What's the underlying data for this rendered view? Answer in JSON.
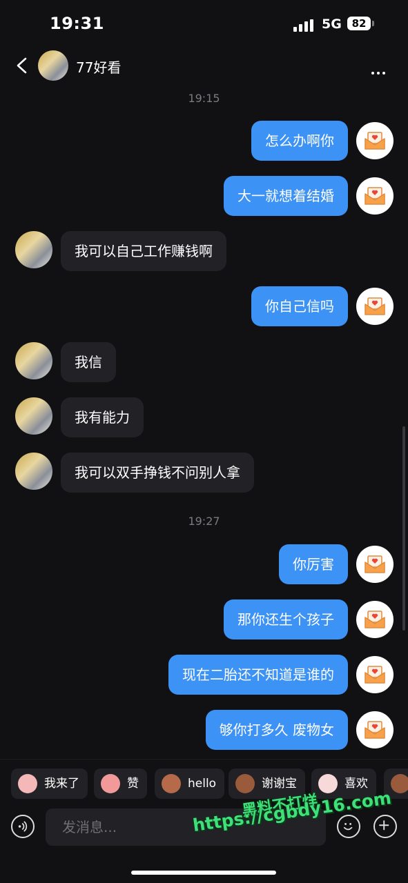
{
  "status_bar": {
    "time": "19:31",
    "network": "5G",
    "battery": "82"
  },
  "header": {
    "name": "77好看"
  },
  "messages": [
    {
      "type": "timestamp",
      "text": "19:15"
    },
    {
      "type": "msg",
      "from": "me",
      "text": "怎么办啊你"
    },
    {
      "type": "msg",
      "from": "me",
      "text": "大一就想着结婚"
    },
    {
      "type": "msg",
      "from": "them",
      "text": "我可以自己工作赚钱啊"
    },
    {
      "type": "msg",
      "from": "me",
      "text": "你自己信吗"
    },
    {
      "type": "msg",
      "from": "them",
      "text": "我信"
    },
    {
      "type": "msg",
      "from": "them",
      "text": "我有能力"
    },
    {
      "type": "msg",
      "from": "them",
      "text": "我可以双手挣钱不问别人拿"
    },
    {
      "type": "timestamp",
      "text": "19:27"
    },
    {
      "type": "msg",
      "from": "me",
      "text": "你厉害"
    },
    {
      "type": "msg",
      "from": "me",
      "text": "那你还生个孩子"
    },
    {
      "type": "msg",
      "from": "me",
      "text": "现在二胎还不知道是谁的"
    },
    {
      "type": "msg",
      "from": "me",
      "text": "够你打多久 废物女"
    }
  ],
  "quick_replies": [
    "我来了",
    "赞",
    "hello",
    "谢谢宝",
    "喜欢"
  ],
  "input": {
    "placeholder": "发消息..."
  },
  "watermark": {
    "line1": "黑料不打烊",
    "line2": "https://cgbdy16.com"
  },
  "colors": {
    "my_bubble": "#3d92f5",
    "their_bubble": "#222226",
    "background": "#111113"
  }
}
